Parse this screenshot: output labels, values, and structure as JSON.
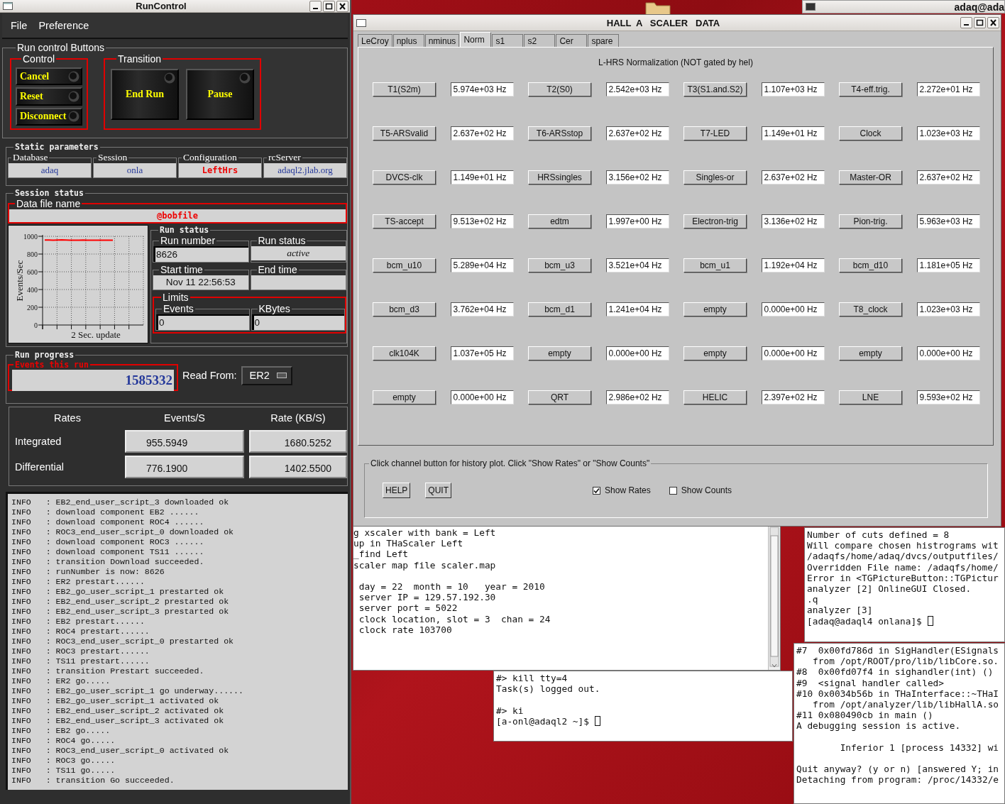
{
  "run_control": {
    "window": {
      "title": "RunControl"
    },
    "menu": [
      "File",
      "Preference"
    ],
    "buttons_group": {
      "title": "Run control Buttons",
      "control": {
        "title": "Control",
        "buttons": [
          "Cancel",
          "Reset",
          "Disconnect"
        ]
      },
      "transition": {
        "title": "Transition",
        "buttons": [
          "End Run",
          "Pause"
        ]
      }
    },
    "static_parameters": {
      "title": "Static parameters",
      "fields": [
        {
          "label": "Database",
          "value": "adaq",
          "kind": "normal"
        },
        {
          "label": "Session",
          "value": "onla",
          "kind": "normal"
        },
        {
          "label": "Configuration",
          "value": "LeftHrs",
          "kind": "highlight"
        },
        {
          "label": "rcServer",
          "value": "adaql2.jlab.org",
          "kind": "normal"
        }
      ]
    },
    "session_status": {
      "title": "Session status",
      "data_file": {
        "label": "Data file name",
        "value": "@bobfile"
      },
      "chart_data": {
        "type": "line",
        "grid": true,
        "xlabel": "2 Sec. update",
        "ylabel": "Events/Sec",
        "ylim": [
          0,
          1000
        ],
        "yticks": [
          0,
          200,
          400,
          600,
          800,
          1000
        ],
        "series": [
          {
            "color": "#ff0000",
            "values": [
              958,
              958,
              957,
              958,
              959,
              958,
              957,
              956,
              957,
              958,
              957,
              956,
              955,
              956,
              957,
              956,
              955
            ]
          }
        ]
      },
      "run_status": {
        "title": "Run status",
        "fields": [
          {
            "label": "Run number",
            "value": "8626",
            "kind": "input"
          },
          {
            "label": "Run status",
            "value": "active",
            "kind": "status"
          },
          {
            "label": "Start time",
            "value": "Nov 11 22:56:53",
            "kind": "display"
          },
          {
            "label": "End time",
            "kind": "display"
          }
        ]
      },
      "limits": {
        "title": "Limits",
        "fields": [
          {
            "label": "Events",
            "value": "0"
          },
          {
            "label": "KBytes",
            "value": "0"
          }
        ]
      }
    },
    "run_progress": {
      "title": "Run progress",
      "events_label": "Events this run",
      "events_value": "1585332",
      "read_from_label": "Read From:",
      "read_from_value": "ER2"
    },
    "rates": {
      "columns": [
        "Rates",
        "Events/S",
        "Rate (KB/S)"
      ],
      "rows": [
        {
          "label": "Integrated",
          "values": [
            "955.5949",
            "1680.5252"
          ]
        },
        {
          "label": "Differential",
          "values": [
            "776.1900",
            "1402.5500"
          ]
        }
      ]
    },
    "log": [
      "INFO   : EB2_end_user_script_3 downloaded ok",
      "INFO   : download component EB2 ......",
      "INFO   : download component ROC4 ......",
      "INFO   : ROC3_end_user_script_0 downloaded ok",
      "INFO   : download component ROC3 ......",
      "INFO   : download component TS11 ......",
      "INFO   : transition Download succeeded.",
      "INFO   : runNumber is now: 8626",
      "INFO   : ER2 prestart......",
      "INFO   : EB2_go_user_script_1 prestarted ok",
      "INFO   : EB2_end_user_script_2 prestarted ok",
      "INFO   : EB2_end_user_script_3 prestarted ok",
      "INFO   : EB2 prestart......",
      "INFO   : ROC4 prestart......",
      "INFO   : ROC3_end_user_script_0 prestarted ok",
      "INFO   : ROC3 prestart......",
      "INFO   : TS11 prestart......",
      "INFO   : transition Prestart succeeded.",
      "INFO   : ER2 go.....",
      "INFO   : EB2_go_user_script_1 go underway......",
      "INFO   : EB2_go_user_script_1 activated ok",
      "INFO   : EB2_end_user_script_2 activated ok",
      "INFO   : EB2_end_user_script_3 activated ok",
      "INFO   : EB2 go.....",
      "INFO   : ROC4 go.....",
      "INFO   : ROC3_end_user_script_0 activated ok",
      "INFO   : ROC3 go.....",
      "INFO   : TS11 go.....",
      "INFO   : transition Go succeeded."
    ]
  },
  "scaler": {
    "window": {
      "title": "HALL  A   SCALER   DATA"
    },
    "tabs": [
      {
        "label": "LeCroy",
        "selected": false
      },
      {
        "label": "nplus",
        "selected": false
      },
      {
        "label": "nminus",
        "selected": false
      },
      {
        "label": "Norm",
        "selected": true
      },
      {
        "label": "s1",
        "selected": false
      },
      {
        "label": "s2",
        "selected": false
      },
      {
        "label": "Cer",
        "selected": false
      },
      {
        "label": "spare",
        "selected": false
      }
    ],
    "heading": "L-HRS Normalization (NOT gated by hel)",
    "channels": [
      {
        "name": "T1(S2m)",
        "reading": "5.974e+03 Hz"
      },
      {
        "name": "T2(S0)",
        "reading": "2.542e+03 Hz"
      },
      {
        "name": "T3(S1.and.S2)",
        "reading": "1.107e+03 Hz"
      },
      {
        "name": "T4-eff.trig.",
        "reading": "2.272e+01 Hz"
      },
      {
        "name": "T5-ARSvalid",
        "reading": "2.637e+02 Hz"
      },
      {
        "name": "T6-ARSstop",
        "reading": "2.637e+02 Hz"
      },
      {
        "name": "T7-LED",
        "reading": "1.149e+01 Hz"
      },
      {
        "name": "Clock",
        "reading": "1.023e+03 Hz"
      },
      {
        "name": "DVCS-clk",
        "reading": "1.149e+01 Hz"
      },
      {
        "name": "HRSsingles",
        "reading": "3.156e+02 Hz"
      },
      {
        "name": "Singles-or",
        "reading": "2.637e+02 Hz"
      },
      {
        "name": "Master-OR",
        "reading": "2.637e+02 Hz"
      },
      {
        "name": "TS-accept",
        "reading": "9.513e+02 Hz"
      },
      {
        "name": "edtm",
        "reading": "1.997e+00 Hz"
      },
      {
        "name": "Electron-trig",
        "reading": "3.136e+02 Hz"
      },
      {
        "name": "Pion-trig.",
        "reading": "5.963e+03 Hz"
      },
      {
        "name": "bcm_u10",
        "reading": "5.289e+04 Hz"
      },
      {
        "name": "bcm_u3",
        "reading": "3.521e+04 Hz"
      },
      {
        "name": "bcm_u1",
        "reading": "1.192e+04 Hz"
      },
      {
        "name": "bcm_d10",
        "reading": "1.181e+05 Hz"
      },
      {
        "name": "bcm_d3",
        "reading": "3.762e+04 Hz"
      },
      {
        "name": "bcm_d1",
        "reading": "1.241e+04 Hz"
      },
      {
        "name": "empty",
        "reading": "0.000e+00 Hz"
      },
      {
        "name": "T8_clock",
        "reading": "1.023e+03 Hz"
      },
      {
        "name": "clk104K",
        "reading": "1.037e+05 Hz"
      },
      {
        "name": "empty",
        "reading": "0.000e+00 Hz"
      },
      {
        "name": "empty",
        "reading": "0.000e+00 Hz"
      },
      {
        "name": "empty",
        "reading": "0.000e+00 Hz"
      },
      {
        "name": "empty",
        "reading": "0.000e+00 Hz"
      },
      {
        "name": "QRT",
        "reading": "2.986e+02 Hz"
      },
      {
        "name": "HELIC",
        "reading": "2.397e+02 Hz"
      },
      {
        "name": "LNE",
        "reading": "9.593e+02 Hz"
      }
    ],
    "footer": {
      "hint": "Click channel button for history plot.  Click \"Show Rates\" or \"Show Counts\"",
      "buttons": [
        "HELP",
        "QUIT"
      ],
      "checkboxes": [
        {
          "label": "Show Rates",
          "checked": true
        },
        {
          "label": "Show Counts",
          "checked": false
        }
      ]
    }
  },
  "top_window": {
    "title": "adaq@ada"
  },
  "terminals": [
    {
      "kind": "scroll",
      "blocks": [
        [
          "g xscaler with bank = Left",
          "up in THaScaler Left",
          "_find Left",
          "scaler map file scaler.map"
        ],
        [
          " day = 22  month = 10   year = 2010",
          " server IP = 129.57.192.30",
          " server port = 5022",
          " clock location, slot = 3  chan = 24",
          " clock rate 103700"
        ]
      ]
    },
    {
      "kind": "plain",
      "blocks": [
        [
          "#> kill tty=4",
          "Task(s) logged out."
        ],
        [
          "#> ki",
          "[a-onl@adaql2 ~]$ "
        ]
      ],
      "cursor": true
    },
    {
      "kind": "plain",
      "blocks": [
        [
          "Number of cuts defined = 8",
          "Will compare chosen histrograms wit",
          "/adaqfs/home/adaq/dvcs/outputfiles/",
          "Overridden File name: /adaqfs/home/",
          "Error in <TGPictureButton::TGPictur",
          "analyzer [2] OnlineGUI Closed.",
          ".q",
          "analyzer [3]",
          "[adaq@adaql4 onlana]$ "
        ]
      ],
      "cursor": true
    },
    {
      "kind": "plain",
      "blocks": [
        [
          "#7  0x00fd786d in SigHandler(ESignals",
          "   from /opt/ROOT/pro/lib/libCore.so.",
          "#8  0x00fd07f4 in sighandler(int) ()",
          "#9  <signal handler called>",
          "#10 0x0034b56b in THaInterface::~THaI",
          "   from /opt/analyzer/lib/libHallA.so",
          "#11 0x080490cb in main ()",
          "A debugging session is active."
        ],
        [
          "        Inferior 1 [process 14332] wi"
        ],
        [
          "Quit anyway? (y or n) [answered Y; in",
          "Detaching from program: /proc/14332/e"
        ]
      ]
    }
  ]
}
